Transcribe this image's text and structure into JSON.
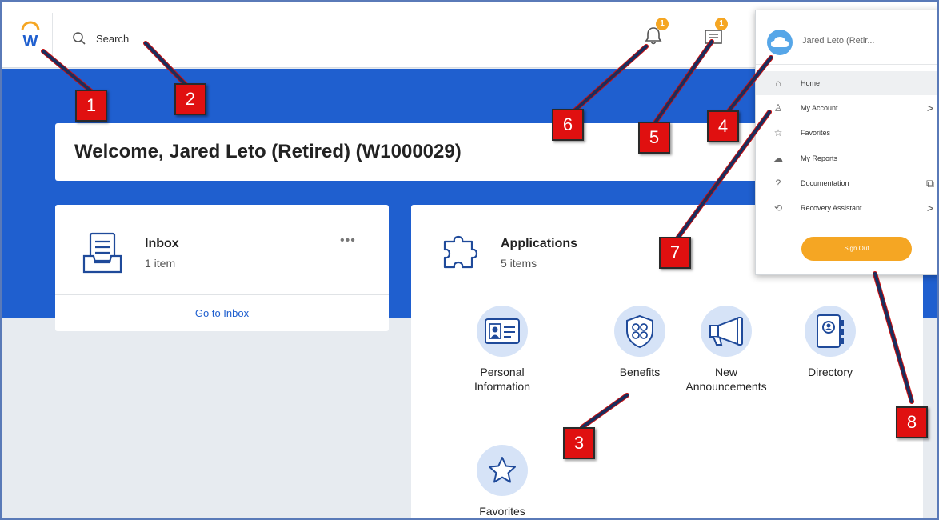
{
  "header": {
    "logo_icon": "workday-logo-icon",
    "search_placeholder": "Search",
    "notifications_badge": "1",
    "inbox_badge": "1"
  },
  "welcome": {
    "text": "Welcome,  Jared Leto (Retired) (W1000029)"
  },
  "inbox_card": {
    "title": "Inbox",
    "count": "1 item",
    "more": "•••",
    "link": "Go to Inbox"
  },
  "apps_card": {
    "title": "Applications",
    "count": "5 items",
    "apps": [
      {
        "label": "Personal Information",
        "icon": "id-card-icon"
      },
      {
        "label": "Benefits",
        "icon": "shield-icon"
      },
      {
        "label": "New Announcements",
        "icon": "megaphone-icon"
      },
      {
        "label": "Directory",
        "icon": "address-book-icon"
      },
      {
        "label": "Favorites",
        "icon": "star-icon"
      }
    ]
  },
  "user_menu": {
    "name": "Jared Leto (Retir...",
    "items": [
      {
        "label": "Home",
        "icon": "home-icon",
        "trail": ""
      },
      {
        "label": "My Account",
        "icon": "person-icon",
        "trail": ">"
      },
      {
        "label": "Favorites",
        "icon": "star-icon",
        "trail": ""
      },
      {
        "label": "My Reports",
        "icon": "cloud-icon",
        "trail": ""
      },
      {
        "label": "Documentation",
        "icon": "help-icon",
        "trail": "⧉"
      },
      {
        "label": "Recovery Assistant",
        "icon": "history-icon",
        "trail": ">"
      }
    ],
    "sign_out": "Sign Out"
  },
  "callouts": [
    "1",
    "2",
    "3",
    "4",
    "5",
    "6",
    "7",
    "8"
  ],
  "colors": {
    "brand_blue": "#1f5fcf",
    "accent_orange": "#f5a623",
    "callout_red": "#e01010"
  }
}
